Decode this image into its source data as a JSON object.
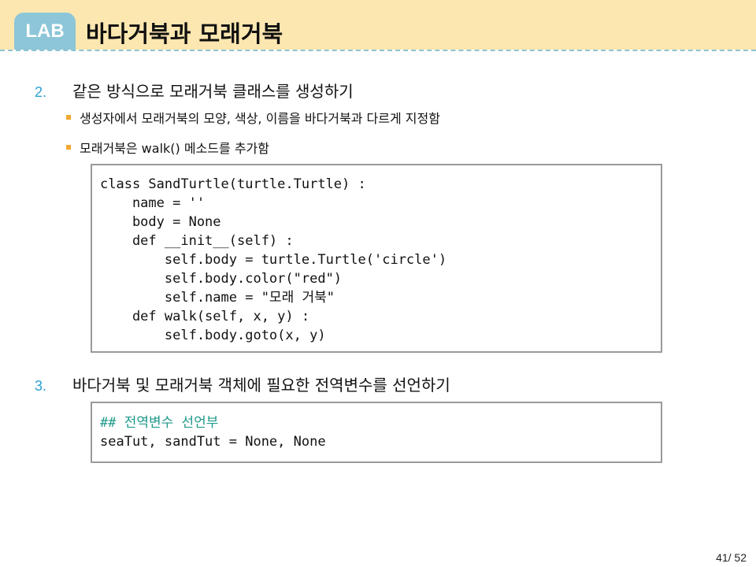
{
  "header": {
    "badge": "LAB",
    "title": "바다거북과 모래거북"
  },
  "steps": [
    {
      "number": "2.",
      "text": "같은 방식으로 모래거북 클래스를 생성하기",
      "bullets": [
        "생성자에서 모래거북의 모양, 색상, 이름을 바다거북과 다르게 지정함",
        "모래거북은 walk() 메소드를 추가함"
      ],
      "code": [
        "class SandTurtle(turtle.Turtle) :",
        "    name = ''",
        "    body = None",
        "    def __init__(self) :",
        "        self.body = turtle.Turtle('circle')",
        "        self.body.color(\"red\")",
        "        self.name = \"모래 거북\"",
        "    def walk(self, x, y) :",
        "        self.body.goto(x, y)"
      ]
    },
    {
      "number": "3.",
      "text": "바다거북 및 모래거북 객체에 필요한 전역변수를 선언하기",
      "bullets": [],
      "code_comment": "## 전역변수 선언부",
      "code": [
        "seaTut, sandTut = None, None"
      ]
    }
  ],
  "page_number": "41/ 52",
  "colors": {
    "header_bg": "#fde7b0",
    "badge_bg": "#8cc6d8",
    "step_number": "#2a9fd0",
    "bullet": "#f0a830",
    "code_comment": "#1f9a8a"
  }
}
